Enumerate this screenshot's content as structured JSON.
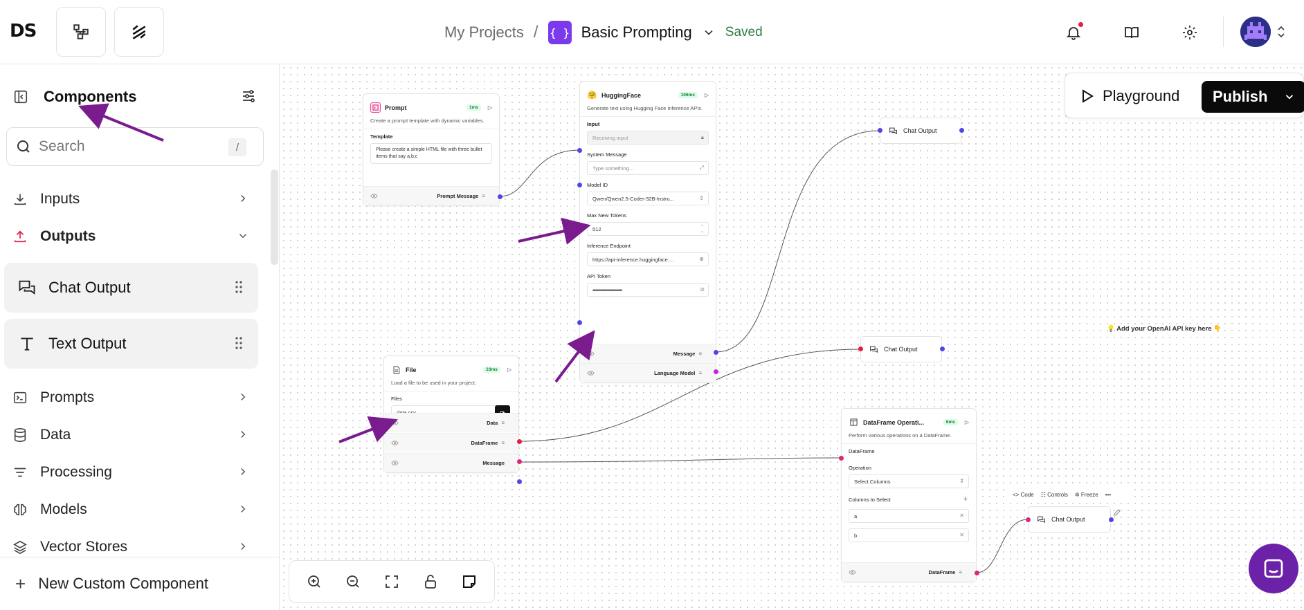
{
  "header": {
    "logo": "DS",
    "breadcrumb": {
      "projects": "My Projects",
      "separator": "/",
      "project_icon": "{ }",
      "project_name": "Basic Prompting",
      "status": "Saved"
    }
  },
  "sidebar": {
    "title": "Components",
    "search_placeholder": "Search",
    "search_shortcut": "/",
    "categories": [
      {
        "label": "Inputs",
        "icon": "download-icon"
      },
      {
        "label": "Outputs",
        "icon": "upload-icon",
        "expanded": true
      },
      {
        "label": "Prompts",
        "icon": "terminal-icon"
      },
      {
        "label": "Data",
        "icon": "database-icon"
      },
      {
        "label": "Processing",
        "icon": "filter-lines-icon"
      },
      {
        "label": "Models",
        "icon": "brain-icon"
      },
      {
        "label": "Vector Stores",
        "icon": "layers-icon"
      }
    ],
    "output_items": [
      {
        "label": "Chat Output",
        "icon": "chat-icon"
      },
      {
        "label": "Text Output",
        "icon": "type-icon"
      }
    ],
    "footer": "New Custom Component"
  },
  "canvas": {
    "actions": {
      "playground": "Playground",
      "publish": "Publish"
    },
    "note": "💡 Add your OpenAI API key here 👇",
    "node_toolbar": {
      "code": "Code",
      "controls": "Controls",
      "freeze": "Freeze"
    },
    "prompt_node": {
      "title": "Prompt",
      "time": "1ms",
      "description": "Create a prompt template with dynamic variables.",
      "template_label": "Template",
      "template_value": "Please create a simple HTML file with three bullet items that say a,b,c",
      "output": "Prompt Message"
    },
    "hf_node": {
      "title": "HuggingFace",
      "time": "106ms",
      "description": "Generate text using Hugging Face Inference APIs.",
      "input_label": "Input",
      "input_value": "Receiving input",
      "system_label": "System Message",
      "system_placeholder": "Type something...",
      "model_label": "Model ID",
      "model_value": "Qwen/Qwen2.5-Coder-32B-Instru...",
      "tokens_label": "Max New Tokens",
      "tokens_value": "512",
      "endpoint_label": "Inference Endpoint",
      "endpoint_value": "https://api-inference.huggingface....",
      "token_label": "API Token",
      "token_value": "••••••••••••••••••••••••••",
      "outputs": [
        "Message",
        "Language Model"
      ]
    },
    "file_node": {
      "title": "File",
      "time": "23ms",
      "description": "Load a file to be used in your project.",
      "files_label": "Files",
      "file_value": "data.csv",
      "outputs": [
        "Data",
        "DataFrame",
        "Message"
      ]
    },
    "df_node": {
      "title": "DataFrame Operati...",
      "time": "6ms",
      "description": "Perform various operations on a DataFrame.",
      "df_label": "DataFrame",
      "op_label": "Operation",
      "op_value": "Select Columns",
      "cols_label": "Columns to Select",
      "cols": [
        "a",
        "b"
      ],
      "output": "DataFrame"
    },
    "chat_outputs": [
      "Chat Output",
      "Chat Output",
      "Chat Output"
    ]
  },
  "colors": {
    "accent": "#7c3aed",
    "publish_bg": "#0a0a0a",
    "arrow": "#7a1b8e",
    "saved": "#2f7a3f"
  }
}
